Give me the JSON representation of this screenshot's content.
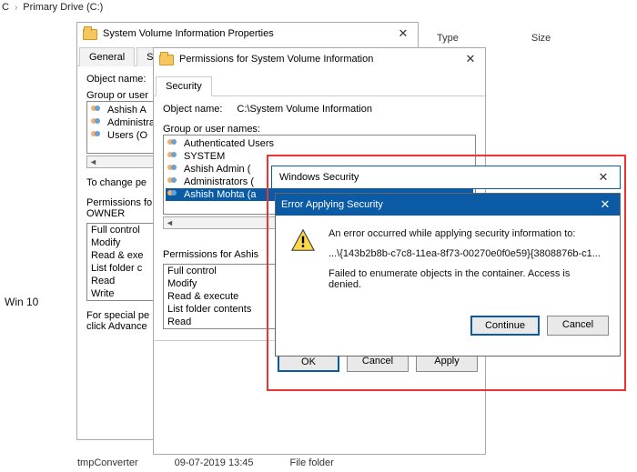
{
  "breadcrumb": {
    "part1": "C",
    "part2": "Primary Drive (C:)"
  },
  "explorer": {
    "col1": "Type",
    "col2": "Size",
    "sidebar_label": "Win 10",
    "bottom1": "tmpConverter",
    "bottom2": "09-07-2019 13:45",
    "bottom3": "File folder"
  },
  "win1": {
    "title": "System Volume Information Properties",
    "tabs": {
      "general": "General",
      "sharing": "Shar"
    },
    "object_label": "Object name:",
    "group_label": "Group or user",
    "users": {
      "u1": "Ashish A",
      "u2": "Administra",
      "u3": "Users (O"
    },
    "changeperm": "To change pe",
    "perm_for_label1": "Permissions fo",
    "perm_for_label2": "OWNER",
    "perms": {
      "p1": "Full control",
      "p2": "Modify",
      "p3": "Read & exe",
      "p4": "List folder c",
      "p5": "Read",
      "p6": "Write"
    },
    "special1": "For special pe",
    "special2": "click Advance"
  },
  "win2": {
    "title": "Permissions for System Volume Information",
    "tab_security": "Security",
    "object_label": "Object name:",
    "object_value": "C:\\System Volume Information",
    "group_label": "Group or user names:",
    "users": {
      "u1": "Authenticated Users",
      "u2": "SYSTEM",
      "u3": "Ashish Admin (",
      "u4": "Administrators (",
      "u5": "Ashish Mohta (a"
    },
    "perm_for": "Permissions for Ashis",
    "perms": {
      "p1": "Full control",
      "p2": "Modify",
      "p3": "Read & execute",
      "p4": "List folder contents",
      "p5": "Read"
    },
    "buttons": {
      "ok": "OK",
      "cancel": "Cancel",
      "apply": "Apply"
    }
  },
  "win3": {
    "title": "Windows Security"
  },
  "win4": {
    "title": "Error Applying Security",
    "line1": "An error occurred while applying security information to:",
    "line2": "...\\{143b2b8b-c7c8-11ea-8f73-00270e0f0e59}{3808876b-c1...",
    "line3": "Failed to enumerate objects in the container. Access is denied.",
    "continue": "Continue",
    "cancel": "Cancel"
  }
}
